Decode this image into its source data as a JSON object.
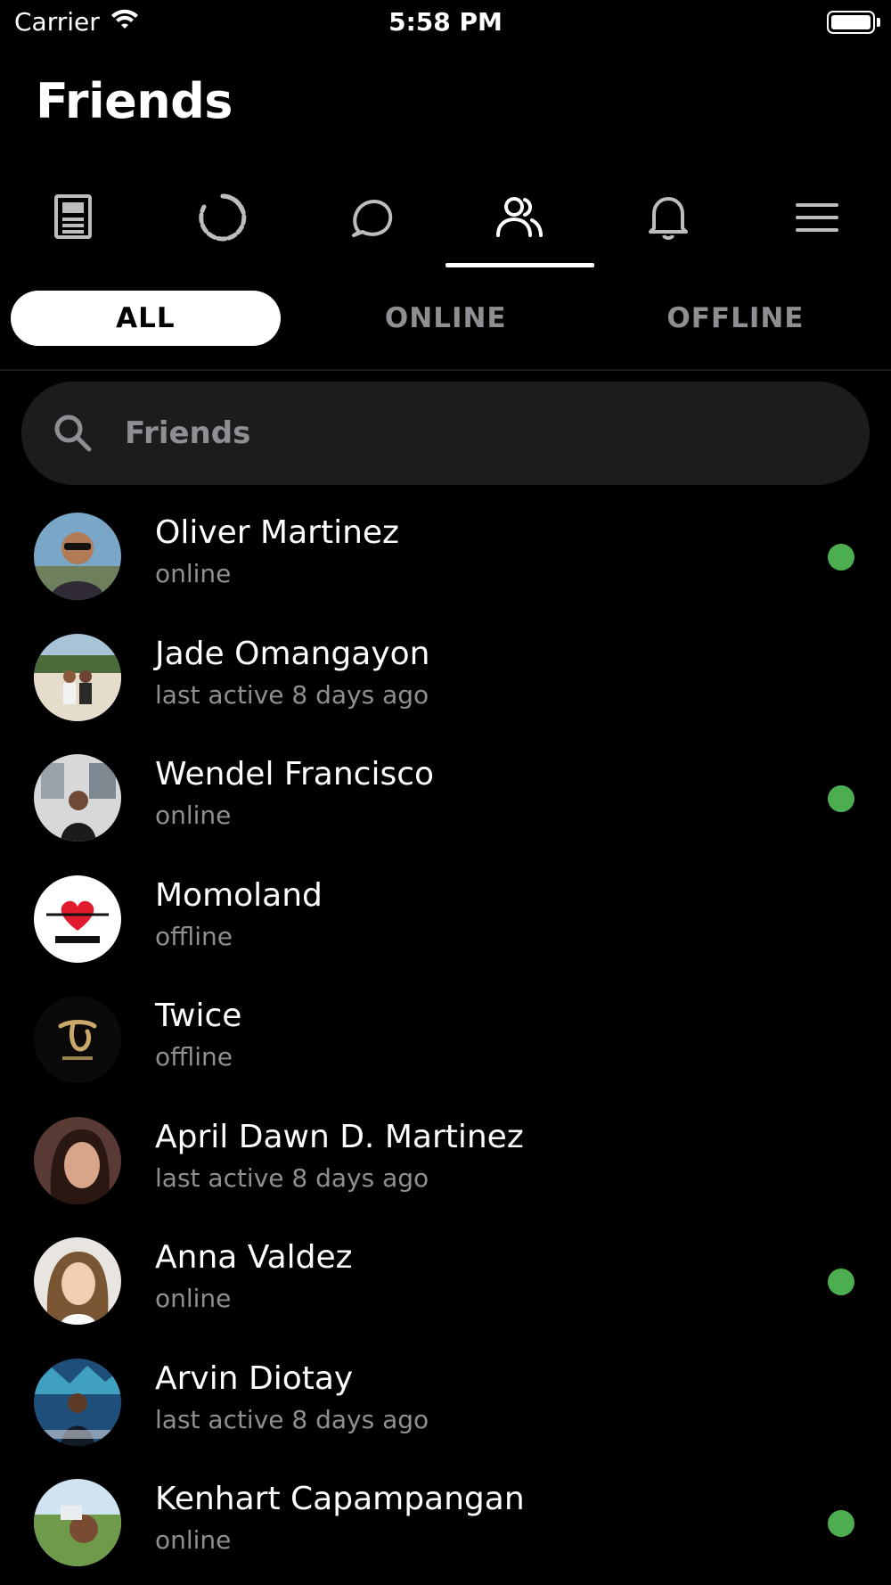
{
  "status_bar": {
    "carrier": "Carrier",
    "time": "5:58 PM"
  },
  "title": "Friends",
  "nav_tabs": [
    {
      "icon": "news-icon",
      "active": false
    },
    {
      "icon": "spinner-icon",
      "active": false
    },
    {
      "icon": "chat-bubble-icon",
      "active": false
    },
    {
      "icon": "people-icon",
      "active": true
    },
    {
      "icon": "bell-icon",
      "active": false
    },
    {
      "icon": "menu-icon",
      "active": false
    }
  ],
  "filter_tabs": [
    {
      "label": "ALL",
      "active": true
    },
    {
      "label": "ONLINE",
      "active": false
    },
    {
      "label": "OFFLINE",
      "active": false
    }
  ],
  "search": {
    "placeholder": "Friends",
    "value": ""
  },
  "colors": {
    "background": "#000000",
    "surface": "#1c1c1e",
    "muted_text": "#8e8e93",
    "online": "#4cae4f"
  },
  "friends": [
    {
      "name": "Oliver Martinez",
      "status": "online",
      "online": true
    },
    {
      "name": "Jade Omangayon",
      "status": "last active 8 days ago",
      "online": false
    },
    {
      "name": "Wendel Francisco",
      "status": "online",
      "online": true
    },
    {
      "name": "Momoland",
      "status": "offline",
      "online": false
    },
    {
      "name": "Twice",
      "status": "offline",
      "online": false
    },
    {
      "name": "April Dawn D. Martinez",
      "status": "last active 8 days ago",
      "online": false
    },
    {
      "name": "Anna Valdez",
      "status": "online",
      "online": true
    },
    {
      "name": "Arvin Diotay",
      "status": "last active 8 days ago",
      "online": false
    },
    {
      "name": "Kenhart Capampangan",
      "status": "online",
      "online": true
    }
  ]
}
